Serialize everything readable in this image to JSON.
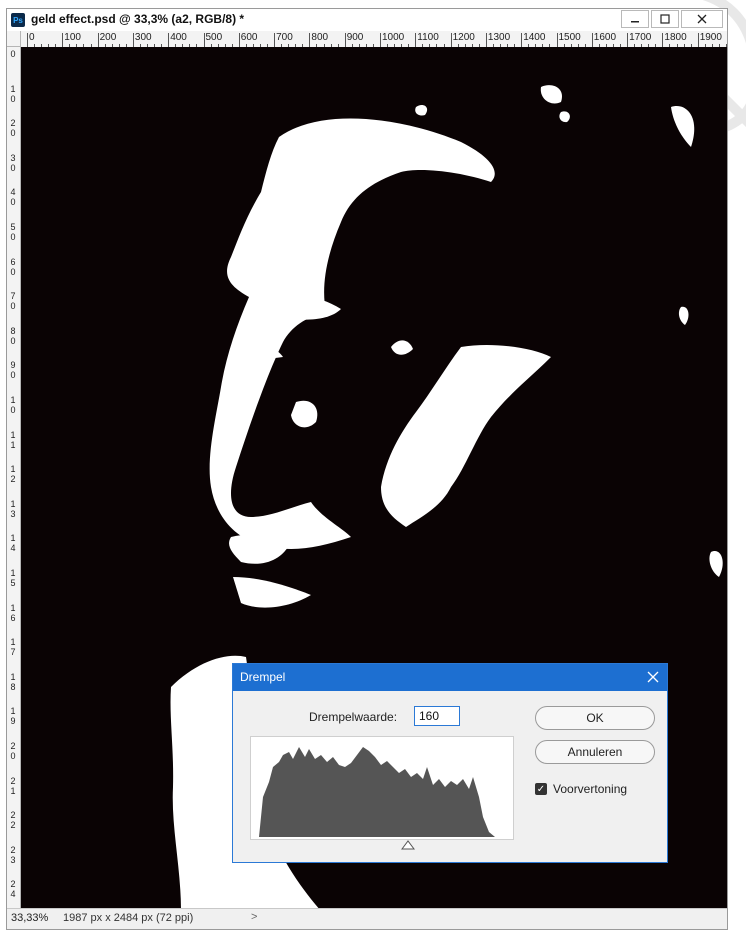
{
  "window": {
    "title": "geld effect.psd @ 33,3% (a2, RGB/8) *",
    "app_icon": "Ps",
    "minimize_icon": "minimize-icon",
    "maximize_icon": "maximize-icon",
    "close_icon": "close-icon"
  },
  "ruler_top": [
    "0",
    "100",
    "200",
    "300",
    "400",
    "500",
    "600",
    "700",
    "800",
    "900",
    "1000",
    "1100",
    "1200",
    "1300",
    "1400",
    "1500",
    "1600",
    "1700",
    "1800",
    "1900"
  ],
  "ruler_left": [
    "0",
    "1\n0",
    "2\n0",
    "3\n0",
    "4\n0",
    "5\n0",
    "6\n0",
    "7\n0",
    "8\n0",
    "9\n0",
    "1\n0",
    "1\n1",
    "1\n2",
    "1\n3",
    "1\n4",
    "1\n5",
    "1\n6",
    "1\n7",
    "1\n8",
    "1\n9",
    "2\n0",
    "2\n1",
    "2\n2",
    "2\n3",
    "2\n4"
  ],
  "status": {
    "zoom": "33,33%",
    "doc_size": "1987 px x 2484 px (72 ppi)",
    "arrow": ">"
  },
  "dialog": {
    "title": "Drempel",
    "threshold_label": "Drempelwaarde:",
    "threshold_value": "160",
    "ok_label": "OK",
    "cancel_label": "Annuleren",
    "preview_label": "Voorvertoning",
    "preview_checked": true
  },
  "colors": {
    "canvas_bg": "#0a0304",
    "dialog_title_bg": "#1d6fd1",
    "histogram_fill": "#555555"
  }
}
